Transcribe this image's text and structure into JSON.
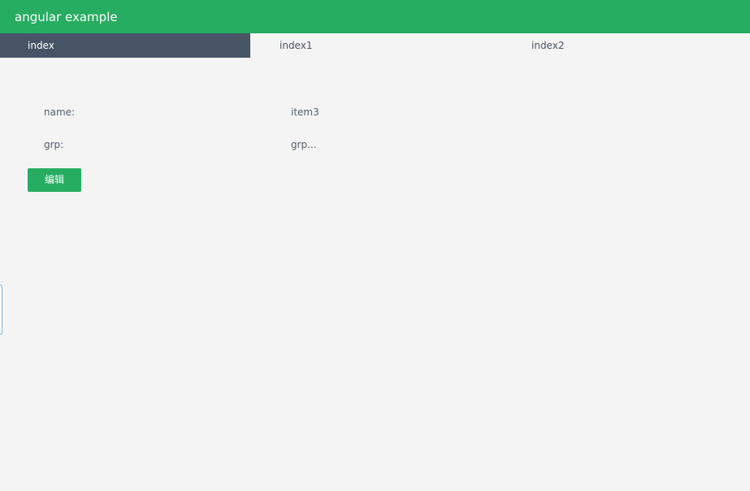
{
  "header": {
    "title": "angular example"
  },
  "tabs": [
    {
      "label": "index",
      "active": true
    },
    {
      "label": "index1",
      "active": false
    },
    {
      "label": "index2",
      "active": false
    }
  ],
  "form": {
    "name_label": "name:",
    "name_value": "item3",
    "grp_label": "grp:",
    "grp_value": "grp..."
  },
  "actions": {
    "edit_label": "编辑"
  },
  "colors": {
    "header_bg": "#26ad61",
    "active_tab_bg": "#465466",
    "page_bg": "#f4f4f4",
    "button_bg": "#26ad61"
  }
}
